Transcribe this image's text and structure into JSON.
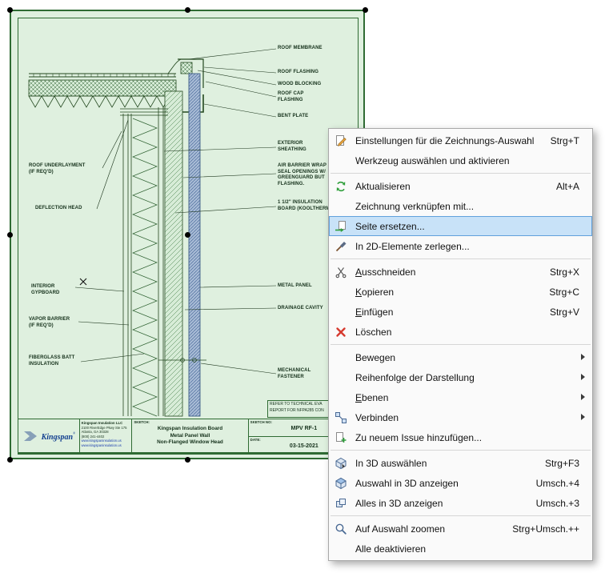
{
  "colors": {
    "page_bg": "#dff0df",
    "page_border": "#2f6b33",
    "menu_highlight": "#c8e2f8",
    "selection_handle": "#000000",
    "metal_panel": "#a9bcd6"
  },
  "drawing": {
    "callouts_right": [
      {
        "text": "ROOF MEMBRANE"
      },
      {
        "text": "ROOF FLASHING"
      },
      {
        "text": "WOOD BLOCKING"
      },
      {
        "text": "ROOF CAP\nFLASHING"
      },
      {
        "text": "BENT PLATE"
      },
      {
        "text": "EXTERIOR\nSHEATHING"
      },
      {
        "text": "AIR BARRIER WRAP\nSEAL OPENINGS W/\nGREENGUARD BUT\nFLASHING."
      },
      {
        "text": "1 1/2\" INSULATION\nBOARD (KOOLTHERM)"
      },
      {
        "text": "METAL PANEL"
      },
      {
        "text": "DRAINAGE CAVITY"
      },
      {
        "text": "MECHANICAL\nFASTENER"
      }
    ],
    "callouts_left": [
      {
        "text": "ROOF UNDERLAYMENT\n(IF REQ'D)"
      },
      {
        "text": "DEFLECTION HEAD"
      },
      {
        "text": "INTERIOR\nGYPBOARD"
      },
      {
        "text": "VAPOR BARRIER\n(IF REQ'D)"
      },
      {
        "text": "FIBERGLASS BATT\nINSULATION"
      }
    ],
    "note_box": {
      "line1": "REFER TO TECHNICAL EVA",
      "line2": "REPORT FOR NFPA285 CON"
    },
    "title_block": {
      "logo_text": "Kingspan",
      "logo_reg": "®",
      "company": "Kingspan Insulation LLC",
      "address1": "2100 RiverEdge Pkwy Ste 175",
      "address2": "Atlanta, GA 30328",
      "phone": "(800) 241-4402",
      "web1": "www.kingspaninsulation.us",
      "web2": "www.kingspaninsulation.us",
      "sketch_label": "SKETCH:",
      "sketch_line1": "Kingspan Insulation Board",
      "sketch_line2": "Metal Panel Wall",
      "sketch_line3": "Non-Flanged Window Head",
      "sketch_no_label": "SKETCH NO:",
      "sketch_no": "MPV RF-1",
      "date_label": "DATE:",
      "date": "03-15-2021"
    }
  },
  "context_menu": {
    "items": [
      {
        "label": "Einstellungen für die Zeichnungs-Auswahl",
        "shortcut": "Strg+T",
        "icon": "drawing-settings-icon"
      },
      {
        "label": "Werkzeug auswählen und aktivieren"
      },
      {
        "type": "separator"
      },
      {
        "label": "Aktualisieren",
        "shortcut": "Alt+A",
        "icon": "refresh-icon"
      },
      {
        "label": "Zeichnung verknüpfen mit..."
      },
      {
        "label": "Seite ersetzen...",
        "icon": "replace-page-icon",
        "highlighted": true
      },
      {
        "label": "In 2D-Elemente zerlegen...",
        "icon": "explode-2d-icon"
      },
      {
        "type": "separator"
      },
      {
        "label": "Ausschneiden",
        "shortcut": "Strg+X",
        "icon": "scissors-icon"
      },
      {
        "label": "Kopieren",
        "shortcut": "Strg+C"
      },
      {
        "label": "Einfügen",
        "shortcut": "Strg+V"
      },
      {
        "label": "Löschen",
        "icon": "delete-icon"
      },
      {
        "type": "separator"
      },
      {
        "label": "Bewegen",
        "submenu": true
      },
      {
        "label": "Reihenfolge der Darstellung",
        "submenu": true
      },
      {
        "label": "Ebenen",
        "submenu": true
      },
      {
        "label": "Verbinden",
        "submenu": true,
        "icon": "connect-icon"
      },
      {
        "label": "Zu neuem Issue hinzufügen...",
        "icon": "add-issue-icon"
      },
      {
        "type": "separator"
      },
      {
        "label": "In 3D auswählen",
        "shortcut": "Strg+F3",
        "icon": "select-in-3d-icon"
      },
      {
        "label": "Auswahl in 3D anzeigen",
        "shortcut": "Umsch.+4",
        "icon": "show-selection-3d-icon"
      },
      {
        "label": "Alles in 3D anzeigen",
        "shortcut": "Umsch.+3",
        "icon": "show-all-3d-icon"
      },
      {
        "type": "separator"
      },
      {
        "label": "Auf Auswahl zoomen",
        "shortcut": "Strg+Umsch.++",
        "icon": "zoom-to-selection-icon"
      },
      {
        "label": "Alle deaktivieren"
      }
    ]
  }
}
